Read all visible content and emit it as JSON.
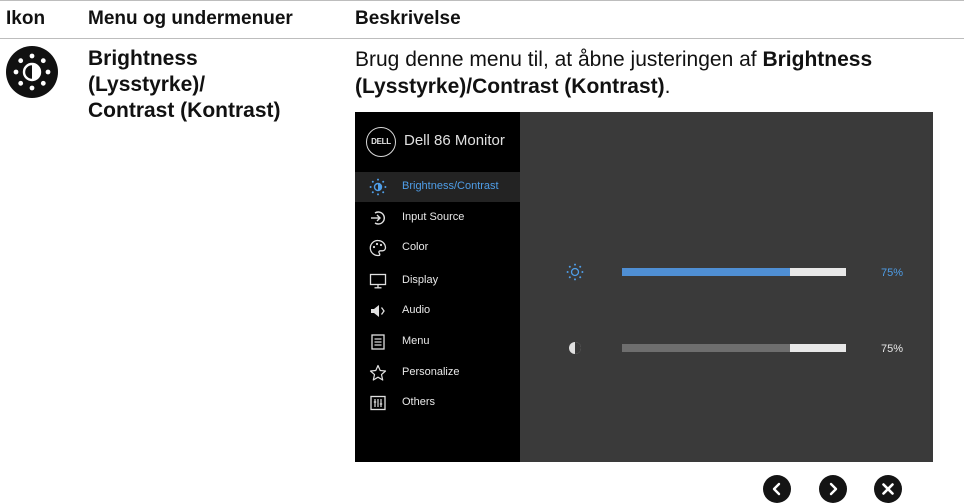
{
  "table": {
    "headers": {
      "icon": "Ikon",
      "menu": "Menu og undermenuer",
      "description": "Beskrivelse"
    },
    "row": {
      "menu_name_lines": [
        "Brightness",
        "(Lysstyrke)/",
        "Contrast (Kontrast)"
      ],
      "description": {
        "prefix": "Brug denne menu til, at åbne justeringen af ",
        "bold": "Brightness (Lysstyrke)/Contrast (Kontrast)",
        "suffix": "."
      }
    }
  },
  "osd": {
    "logo_text": "DELL",
    "monitor_name": "Dell 86 Monitor",
    "menu_items": [
      {
        "label": "Brightness/Contrast",
        "icon": "brightness-icon",
        "active": true
      },
      {
        "label": "Input Source",
        "icon": "input-source-icon",
        "active": false
      },
      {
        "label": "Color",
        "icon": "color-palette-icon",
        "active": false
      },
      {
        "label": "Display",
        "icon": "display-icon",
        "active": false
      },
      {
        "label": "Audio",
        "icon": "speaker-icon",
        "active": false
      },
      {
        "label": "Menu",
        "icon": "menu-icon",
        "active": false
      },
      {
        "label": "Personalize",
        "icon": "star-icon",
        "active": false
      },
      {
        "label": "Others",
        "icon": "others-icon",
        "active": false
      }
    ],
    "brightness": {
      "value": 75,
      "label": "75%",
      "color": "#4f8fd4"
    },
    "contrast": {
      "value": 75,
      "label": "75%",
      "color": "#6e6e6e"
    }
  },
  "nav_buttons": [
    {
      "icon": "chevron-left-icon"
    },
    {
      "icon": "chevron-right-icon"
    },
    {
      "icon": "close-icon"
    }
  ],
  "colors": {
    "accent": "#4f9ee8",
    "osd_panel": "#3a3a3a",
    "osd_sidebar": "#000000"
  }
}
